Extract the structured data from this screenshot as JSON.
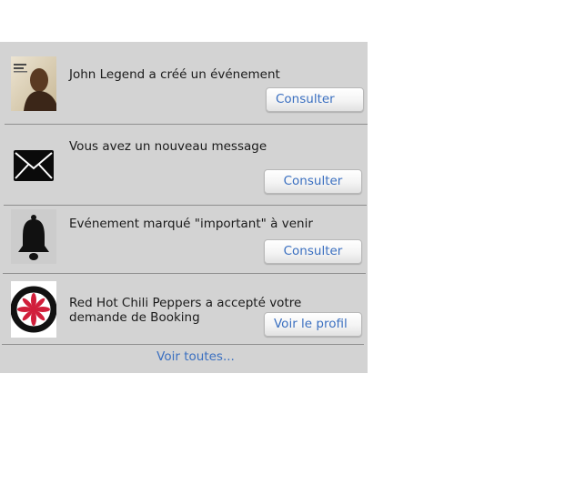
{
  "notifications": [
    {
      "icon": "album-cover-john-legend-icon",
      "text": "John Legend a créé un événement",
      "action": "Consulter"
    },
    {
      "icon": "envelope-icon",
      "text": "Vous avez un nouveau message",
      "action": "Consulter"
    },
    {
      "icon": "bell-icon",
      "text": "Evénement marqué \"important\" à venir",
      "action": "Consulter"
    },
    {
      "icon": "red-hot-chili-peppers-logo-icon",
      "text_line1": "Red Hot Chili Peppers a accepté votre",
      "text_line2": "demande de Booking",
      "action": "Voir le profil"
    }
  ],
  "footer": {
    "link": "Voir toutes..."
  },
  "colors": {
    "panel_bg": "#d3d3d3",
    "link": "#3a6fc0",
    "separator": "#8f8f8f",
    "rhcp_red": "#d11f3b"
  }
}
